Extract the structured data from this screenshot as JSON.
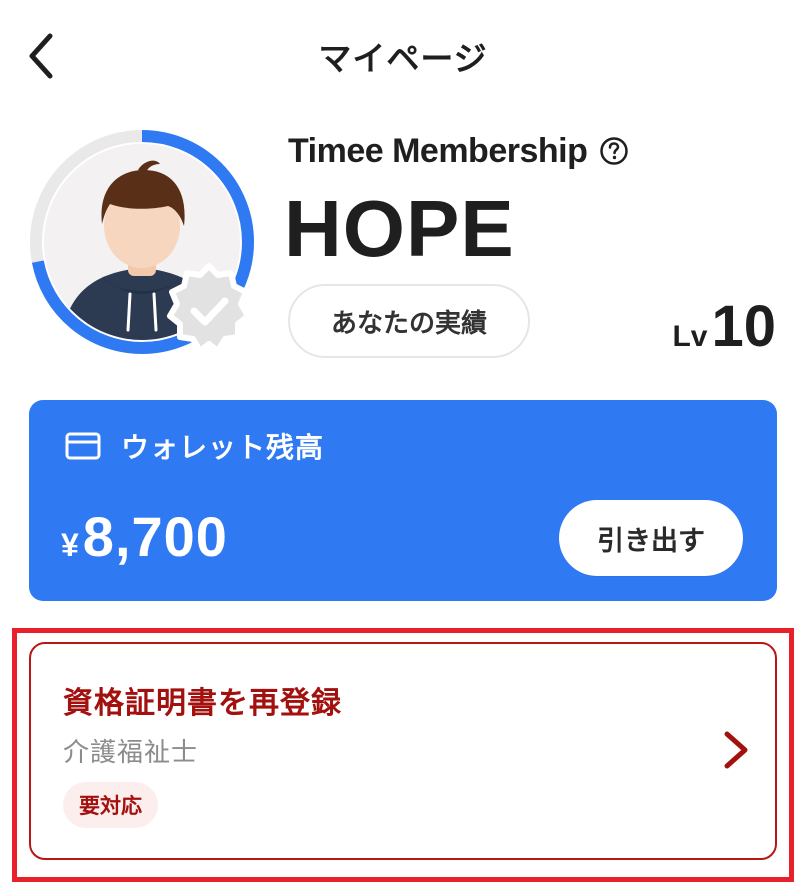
{
  "header": {
    "title": "マイページ",
    "back_icon": "chevron-left-icon"
  },
  "profile": {
    "membership_label": "Timee Membership",
    "help_icon": "question-circle-icon",
    "rank_name": "HOPE",
    "achievements_label": "あなたの実績",
    "level_prefix": "Lv",
    "level_value": "10",
    "level_progress_fraction": 0.72,
    "verified_icon": "verified-badge-icon"
  },
  "wallet": {
    "icon": "credit-card-icon",
    "title": "ウォレット残高",
    "currency": "¥",
    "amount": "8,700",
    "withdraw_label": "引き出す"
  },
  "alert_card": {
    "title": "資格証明書を再登録",
    "subtitle": "介護福祉士",
    "badge": "要対応",
    "chevron_icon": "chevron-right-icon"
  },
  "colors": {
    "accent_blue": "#2f7af3",
    "alert_red": "#a3110e",
    "highlight_red": "#e8202a",
    "text_dark": "#1f1f1f"
  }
}
